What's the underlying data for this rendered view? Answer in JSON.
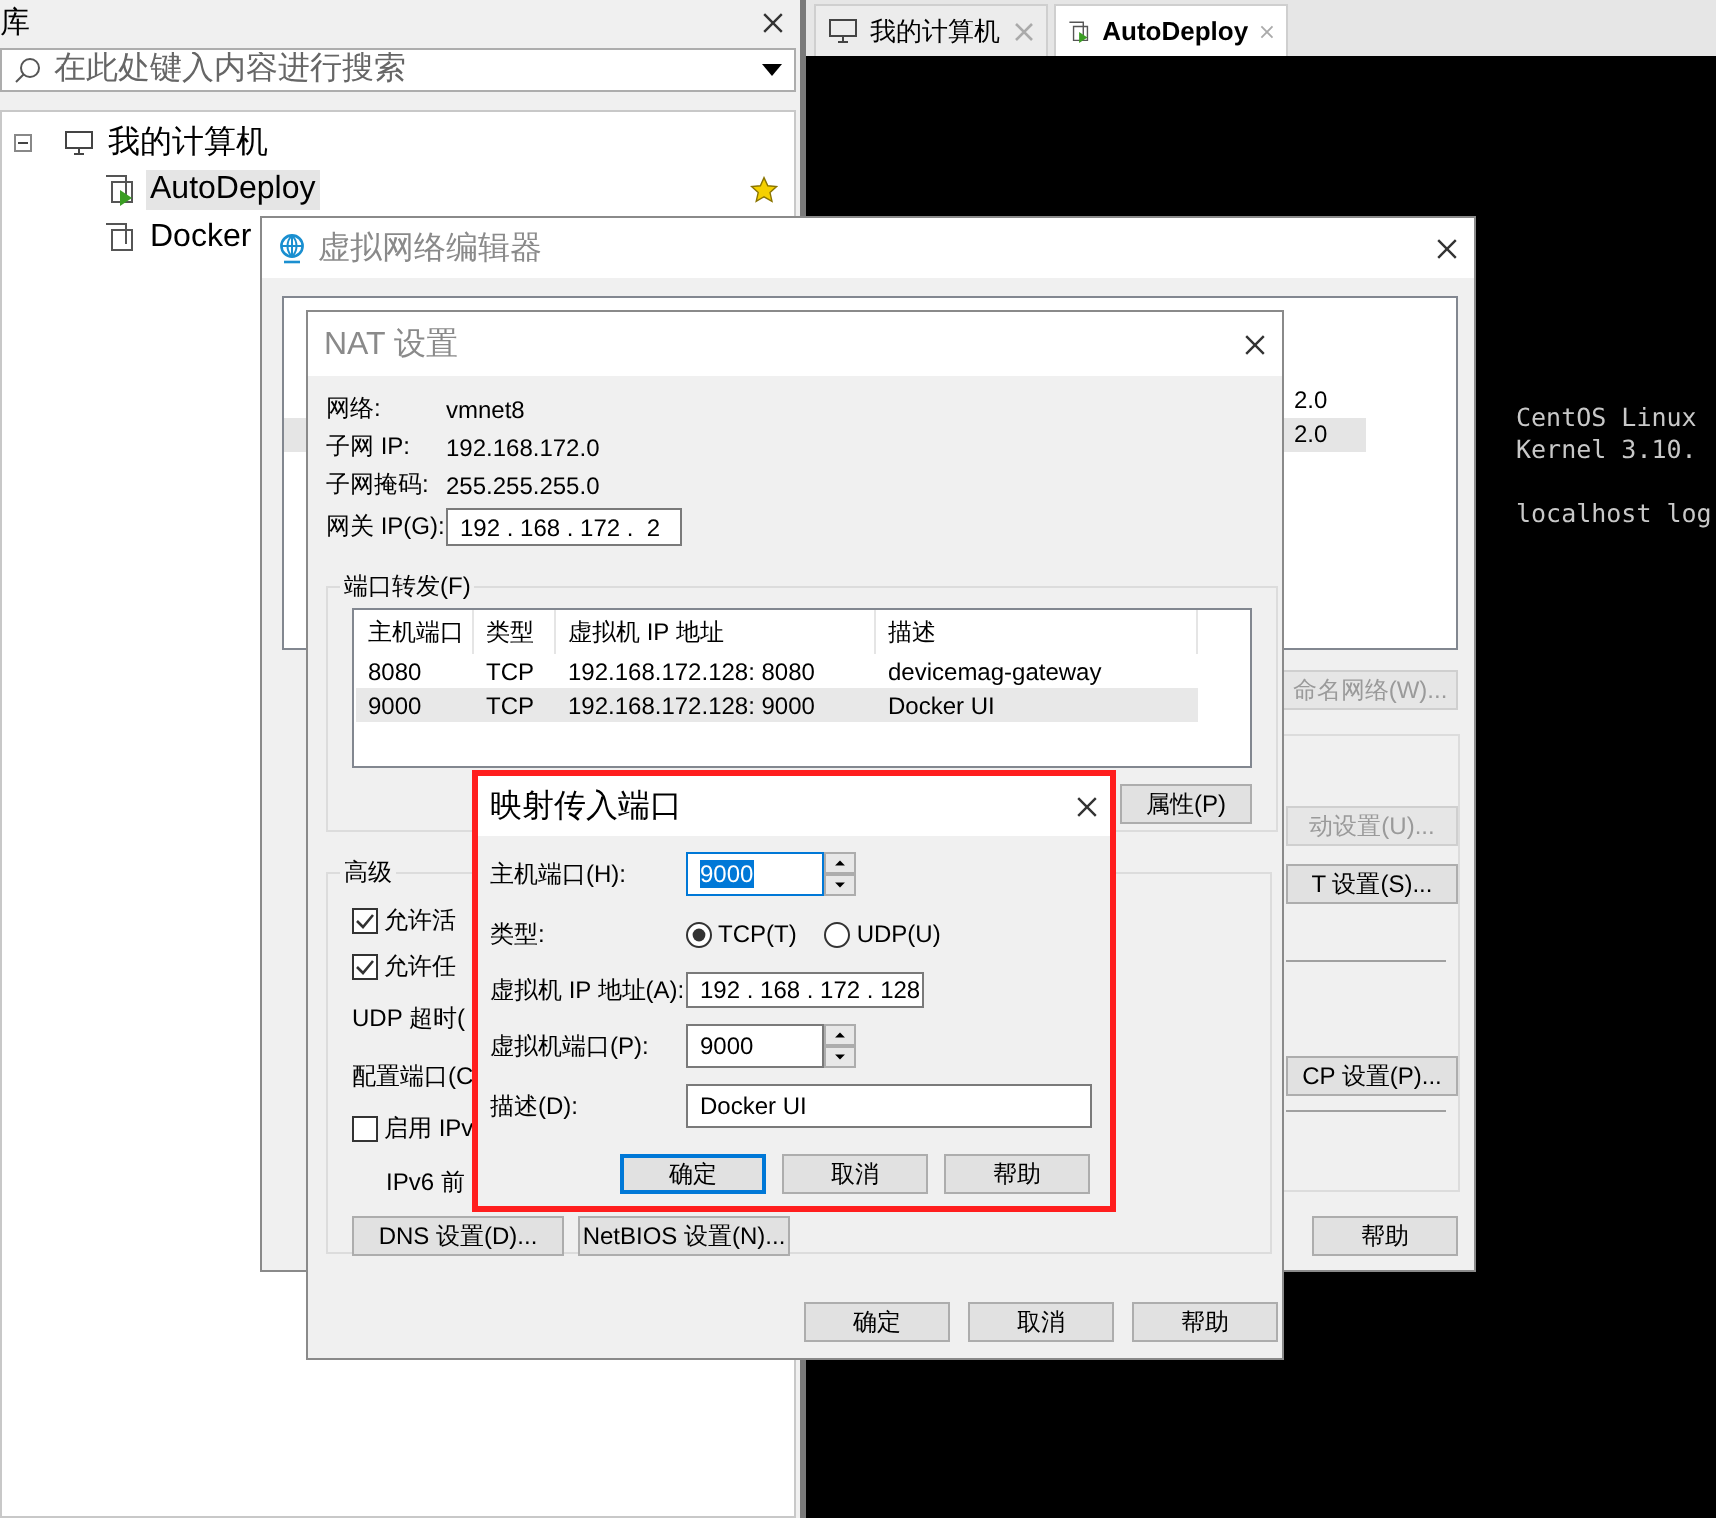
{
  "library": {
    "title": "库",
    "search": {
      "placeholder": "在此处键入内容进行搜索"
    },
    "tree": [
      {
        "label": "我的计算机",
        "expanded": true,
        "children": [
          {
            "label": "AutoDeploy",
            "selected": true,
            "running": true,
            "favorite": true
          },
          {
            "label": "Docker",
            "selected": false,
            "running": false
          }
        ]
      }
    ]
  },
  "tabs": [
    {
      "label": "我的计算机",
      "kind": "computer",
      "selected": false
    },
    {
      "label": "AutoDeploy",
      "kind": "vm",
      "selected": true
    }
  ],
  "console": {
    "lines": [
      "CentOS Linux",
      "Kernel 3.10."
    ],
    "prompt": "localhost log"
  },
  "network_editor": {
    "title": "虚拟网络编辑器",
    "list": {
      "rows": [
        {
          "column_4": "2.0",
          "selected": false
        },
        {
          "column_4": "2.0",
          "selected": true
        }
      ]
    },
    "buttons": [
      {
        "label": "命名网络(W)...",
        "disabled": true
      },
      {
        "label": "动设置(U)...",
        "disabled": true
      },
      {
        "label": "T 设置(S)...",
        "disabled": false
      },
      {
        "label": "CP 设置(P)...",
        "disabled": false
      },
      {
        "label": "帮助",
        "disabled": false
      }
    ]
  },
  "nat_dialog": {
    "title": "NAT 设置",
    "info": [
      {
        "label": "网络:",
        "value": "vmnet8"
      },
      {
        "label": "子网 IP:",
        "value": "192.168.172.0"
      },
      {
        "label": "子网掩码:",
        "value": "255.255.255.0"
      }
    ],
    "gateway": {
      "label": "网关 IP(G):",
      "value": "192 . 168 . 172 .  2"
    },
    "port_forwarding": {
      "title": "端口转发(F)",
      "columns": [
        "主机端口",
        "类型",
        "虚拟机 IP 地址",
        "描述"
      ],
      "rows": [
        {
          "cells": [
            "8080",
            "TCP",
            "192.168.172.128: 8080",
            "devicemag-gateway"
          ],
          "selected": false
        },
        {
          "cells": [
            "9000",
            "TCP",
            "192.168.172.128: 9000",
            "Docker UI"
          ],
          "selected": true
        }
      ],
      "buttons": [
        "属性(P)"
      ]
    },
    "advanced": {
      "title": "高级",
      "options": [
        {
          "kind": "checkbox",
          "label": "允许活",
          "checked": true
        },
        {
          "kind": "checkbox",
          "label": "允许任",
          "checked": true
        },
        {
          "kind": "text",
          "label": "UDP 超时("
        },
        {
          "kind": "text",
          "label": "配置端口(C"
        },
        {
          "kind": "checkbox",
          "label": "启用 IPv",
          "checked": false
        },
        {
          "kind": "subtext",
          "label": "IPv6 前"
        }
      ],
      "buttons": [
        "DNS 设置(D)...",
        "NetBIOS 设置(N)..."
      ]
    },
    "buttons": [
      "确定",
      "取消",
      "帮助"
    ]
  },
  "mapping_dialog": {
    "title": "映射传入端口",
    "fields": [
      {
        "kind": "spin",
        "label": "主机端口(H):",
        "value": "9000",
        "focused": true
      },
      {
        "kind": "radio",
        "label": "类型:",
        "options": [
          {
            "label": "TCP(T)",
            "selected": true
          },
          {
            "label": "UDP(U)",
            "selected": false
          }
        ]
      },
      {
        "kind": "ip",
        "label": "虚拟机 IP 地址(A):",
        "value": "192 . 168 . 172 . 128"
      },
      {
        "kind": "spin",
        "label": "虚拟机端口(P):",
        "value": "9000",
        "focused": false
      },
      {
        "kind": "text",
        "label": "描述(D):",
        "value": "Docker UI"
      }
    ],
    "buttons": [
      {
        "label": "确定",
        "default": true
      },
      {
        "label": "取消",
        "default": false
      },
      {
        "label": "帮助",
        "default": false
      }
    ]
  }
}
